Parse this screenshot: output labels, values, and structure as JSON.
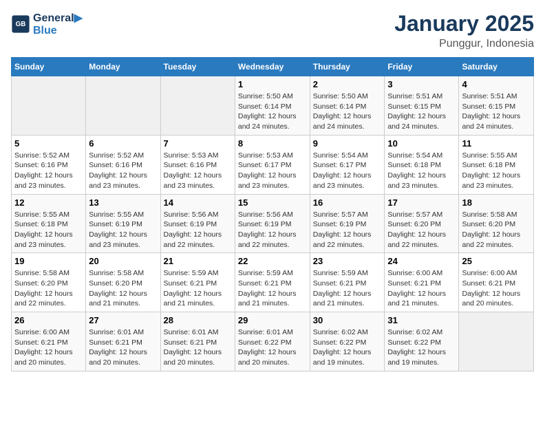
{
  "header": {
    "logo_line1": "General",
    "logo_line2": "Blue",
    "title": "January 2025",
    "subtitle": "Punggur, Indonesia"
  },
  "calendar": {
    "days_of_week": [
      "Sunday",
      "Monday",
      "Tuesday",
      "Wednesday",
      "Thursday",
      "Friday",
      "Saturday"
    ],
    "weeks": [
      [
        {
          "day": "",
          "info": ""
        },
        {
          "day": "",
          "info": ""
        },
        {
          "day": "",
          "info": ""
        },
        {
          "day": "1",
          "info": "Sunrise: 5:50 AM\nSunset: 6:14 PM\nDaylight: 12 hours\nand 24 minutes."
        },
        {
          "day": "2",
          "info": "Sunrise: 5:50 AM\nSunset: 6:14 PM\nDaylight: 12 hours\nand 24 minutes."
        },
        {
          "day": "3",
          "info": "Sunrise: 5:51 AM\nSunset: 6:15 PM\nDaylight: 12 hours\nand 24 minutes."
        },
        {
          "day": "4",
          "info": "Sunrise: 5:51 AM\nSunset: 6:15 PM\nDaylight: 12 hours\nand 24 minutes."
        }
      ],
      [
        {
          "day": "5",
          "info": "Sunrise: 5:52 AM\nSunset: 6:16 PM\nDaylight: 12 hours\nand 23 minutes."
        },
        {
          "day": "6",
          "info": "Sunrise: 5:52 AM\nSunset: 6:16 PM\nDaylight: 12 hours\nand 23 minutes."
        },
        {
          "day": "7",
          "info": "Sunrise: 5:53 AM\nSunset: 6:16 PM\nDaylight: 12 hours\nand 23 minutes."
        },
        {
          "day": "8",
          "info": "Sunrise: 5:53 AM\nSunset: 6:17 PM\nDaylight: 12 hours\nand 23 minutes."
        },
        {
          "day": "9",
          "info": "Sunrise: 5:54 AM\nSunset: 6:17 PM\nDaylight: 12 hours\nand 23 minutes."
        },
        {
          "day": "10",
          "info": "Sunrise: 5:54 AM\nSunset: 6:18 PM\nDaylight: 12 hours\nand 23 minutes."
        },
        {
          "day": "11",
          "info": "Sunrise: 5:55 AM\nSunset: 6:18 PM\nDaylight: 12 hours\nand 23 minutes."
        }
      ],
      [
        {
          "day": "12",
          "info": "Sunrise: 5:55 AM\nSunset: 6:18 PM\nDaylight: 12 hours\nand 23 minutes."
        },
        {
          "day": "13",
          "info": "Sunrise: 5:55 AM\nSunset: 6:19 PM\nDaylight: 12 hours\nand 23 minutes."
        },
        {
          "day": "14",
          "info": "Sunrise: 5:56 AM\nSunset: 6:19 PM\nDaylight: 12 hours\nand 22 minutes."
        },
        {
          "day": "15",
          "info": "Sunrise: 5:56 AM\nSunset: 6:19 PM\nDaylight: 12 hours\nand 22 minutes."
        },
        {
          "day": "16",
          "info": "Sunrise: 5:57 AM\nSunset: 6:19 PM\nDaylight: 12 hours\nand 22 minutes."
        },
        {
          "day": "17",
          "info": "Sunrise: 5:57 AM\nSunset: 6:20 PM\nDaylight: 12 hours\nand 22 minutes."
        },
        {
          "day": "18",
          "info": "Sunrise: 5:58 AM\nSunset: 6:20 PM\nDaylight: 12 hours\nand 22 minutes."
        }
      ],
      [
        {
          "day": "19",
          "info": "Sunrise: 5:58 AM\nSunset: 6:20 PM\nDaylight: 12 hours\nand 22 minutes."
        },
        {
          "day": "20",
          "info": "Sunrise: 5:58 AM\nSunset: 6:20 PM\nDaylight: 12 hours\nand 21 minutes."
        },
        {
          "day": "21",
          "info": "Sunrise: 5:59 AM\nSunset: 6:21 PM\nDaylight: 12 hours\nand 21 minutes."
        },
        {
          "day": "22",
          "info": "Sunrise: 5:59 AM\nSunset: 6:21 PM\nDaylight: 12 hours\nand 21 minutes."
        },
        {
          "day": "23",
          "info": "Sunrise: 5:59 AM\nSunset: 6:21 PM\nDaylight: 12 hours\nand 21 minutes."
        },
        {
          "day": "24",
          "info": "Sunrise: 6:00 AM\nSunset: 6:21 PM\nDaylight: 12 hours\nand 21 minutes."
        },
        {
          "day": "25",
          "info": "Sunrise: 6:00 AM\nSunset: 6:21 PM\nDaylight: 12 hours\nand 20 minutes."
        }
      ],
      [
        {
          "day": "26",
          "info": "Sunrise: 6:00 AM\nSunset: 6:21 PM\nDaylight: 12 hours\nand 20 minutes."
        },
        {
          "day": "27",
          "info": "Sunrise: 6:01 AM\nSunset: 6:21 PM\nDaylight: 12 hours\nand 20 minutes."
        },
        {
          "day": "28",
          "info": "Sunrise: 6:01 AM\nSunset: 6:21 PM\nDaylight: 12 hours\nand 20 minutes."
        },
        {
          "day": "29",
          "info": "Sunrise: 6:01 AM\nSunset: 6:22 PM\nDaylight: 12 hours\nand 20 minutes."
        },
        {
          "day": "30",
          "info": "Sunrise: 6:02 AM\nSunset: 6:22 PM\nDaylight: 12 hours\nand 19 minutes."
        },
        {
          "day": "31",
          "info": "Sunrise: 6:02 AM\nSunset: 6:22 PM\nDaylight: 12 hours\nand 19 minutes."
        },
        {
          "day": "",
          "info": ""
        }
      ]
    ]
  }
}
